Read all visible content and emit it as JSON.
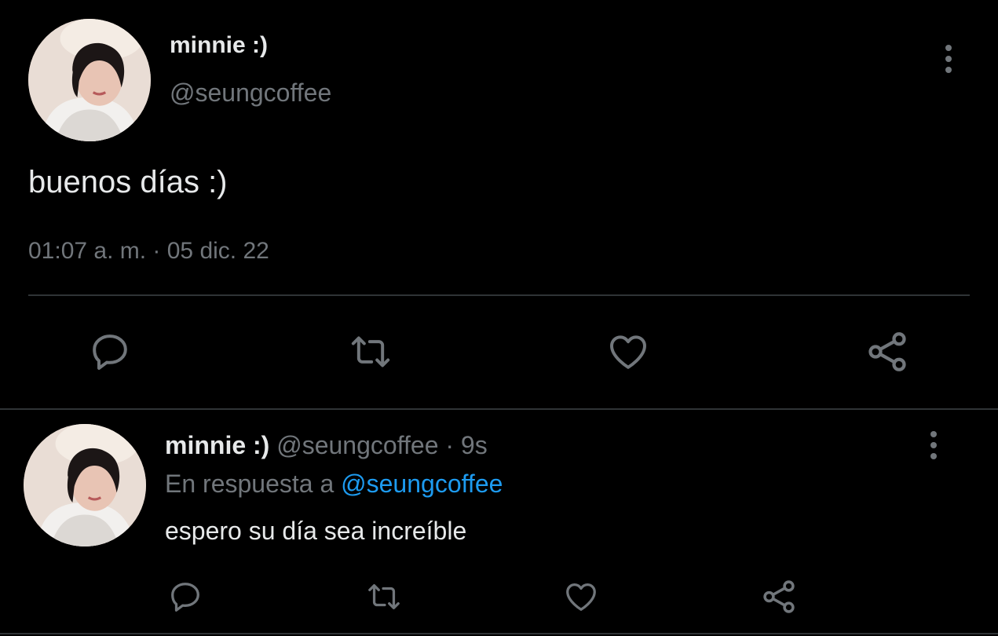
{
  "main_tweet": {
    "display_name": "minnie :)",
    "handle": "@seungcoffee",
    "text": "buenos días :)",
    "timestamp": "01:07 a. m. · 05 dic. 22",
    "actions": [
      "reply-icon",
      "retweet-icon",
      "like-icon",
      "share-icon"
    ]
  },
  "reply_tweet": {
    "display_name": "minnie :)",
    "handle": "@seungcoffee",
    "separator": "·",
    "time_ago": "9s",
    "reply_prefix": "En respuesta a",
    "reply_to": "@seungcoffee",
    "text": "espero su día sea increíble",
    "actions": [
      "reply-icon",
      "retweet-icon",
      "like-icon",
      "share-icon"
    ]
  },
  "colors": {
    "background": "#000000",
    "text": "#e7e9ea",
    "muted": "#71767b",
    "accent": "#1d9bf0",
    "divider": "#2f3336"
  }
}
